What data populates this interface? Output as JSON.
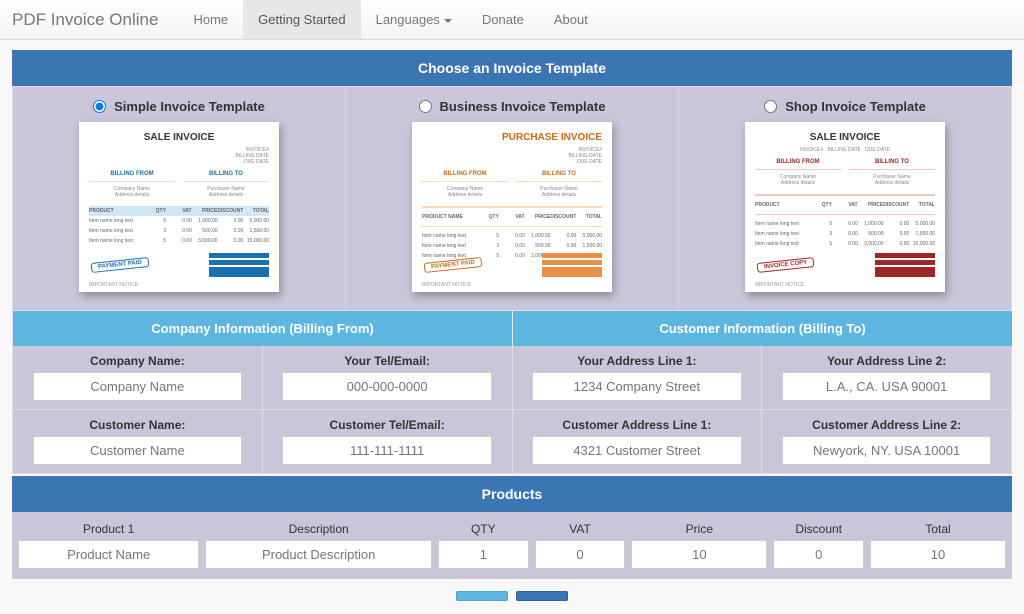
{
  "nav": {
    "brand": "PDF Invoice Online",
    "items": [
      {
        "label": "Home"
      },
      {
        "label": "Getting Started",
        "active": true
      },
      {
        "label": "Languages",
        "dropdown": true
      },
      {
        "label": "Donate"
      },
      {
        "label": "About"
      }
    ]
  },
  "section_template": {
    "title": "Choose an Invoice Template",
    "options": [
      {
        "label": "Simple Invoice Template",
        "thumb_title": "SALE INVOICE",
        "stamp": "PAYMENT PAID",
        "billing_from": "BILLING FROM",
        "billing_to": "BILLING TO",
        "selected": true,
        "theme": "blue"
      },
      {
        "label": "Business Invoice Template",
        "thumb_title": "PURCHASE INVOICE",
        "stamp": "PAYMENT PAID",
        "billing_from": "BILLING FROM",
        "billing_to": "BILLING TO",
        "selected": false,
        "theme": "orange"
      },
      {
        "label": "Shop Invoice Template",
        "thumb_title": "SALE INVOICE",
        "stamp": "INVOICE COPY",
        "billing_from": "BILLING FROM",
        "billing_to": "BILLING TO",
        "selected": false,
        "theme": "red"
      }
    ]
  },
  "subheads": {
    "company": "Company Information (Billing From)",
    "customer": "Customer Information (Billing To)"
  },
  "company_row": [
    {
      "label": "Company Name:",
      "placeholder": "Company Name"
    },
    {
      "label": "Your Tel/Email:",
      "placeholder": "000-000-0000"
    },
    {
      "label": "Your Address Line 1:",
      "placeholder": "1234 Company Street"
    },
    {
      "label": "Your Address Line 2:",
      "placeholder": "L.A., CA. USA 90001"
    }
  ],
  "customer_row": [
    {
      "label": "Customer Name:",
      "placeholder": "Customer Name"
    },
    {
      "label": "Customer Tel/Email:",
      "placeholder": "111-111-1111"
    },
    {
      "label": "Customer Address Line 1:",
      "placeholder": "4321 Customer Street"
    },
    {
      "label": "Customer Address Line 2:",
      "placeholder": "Newyork, NY. USA 10001"
    }
  ],
  "products": {
    "title": "Products",
    "row": {
      "product_label": "Product 1",
      "product_ph": "Product Name",
      "desc_label": "Description",
      "desc_ph": "Product Description",
      "qty_label": "QTY",
      "qty_ph": "1",
      "vat_label": "VAT",
      "vat_ph": "0",
      "price_label": "Price",
      "price_ph": "10",
      "discount_label": "Discount",
      "discount_ph": "0",
      "total_label": "Total",
      "total_ph": "10"
    }
  }
}
